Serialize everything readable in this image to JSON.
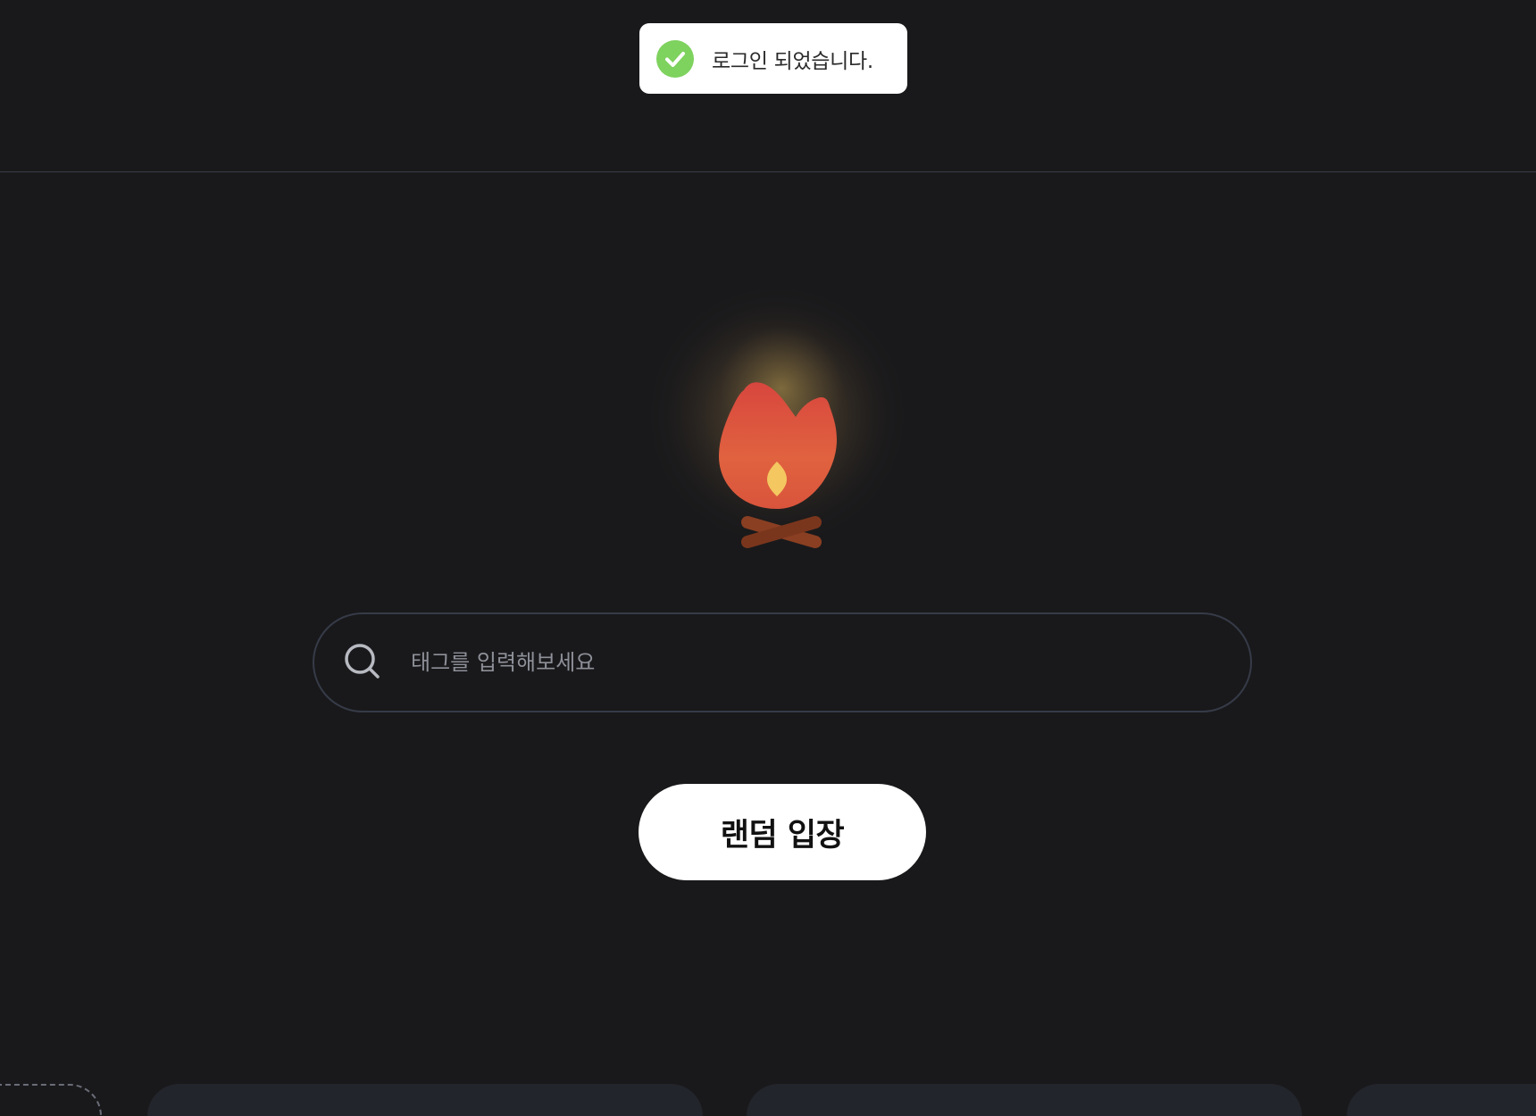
{
  "toast": {
    "message": "로그인 되었습니다.",
    "icon": "check-circle-icon",
    "icon_color": "#7ed25e"
  },
  "search": {
    "placeholder": "태그를 입력해보세요",
    "value": "",
    "icon": "search-icon"
  },
  "hero": {
    "icon": "campfire-icon",
    "flame_color": "#e0553f",
    "inner_flame_color": "#f4c760",
    "log_color": "#8a3f22"
  },
  "actions": {
    "random_enter_label": "랜덤 입장"
  },
  "colors": {
    "background": "#19191b",
    "divider": "#3a3d48",
    "card": "#23252c"
  }
}
